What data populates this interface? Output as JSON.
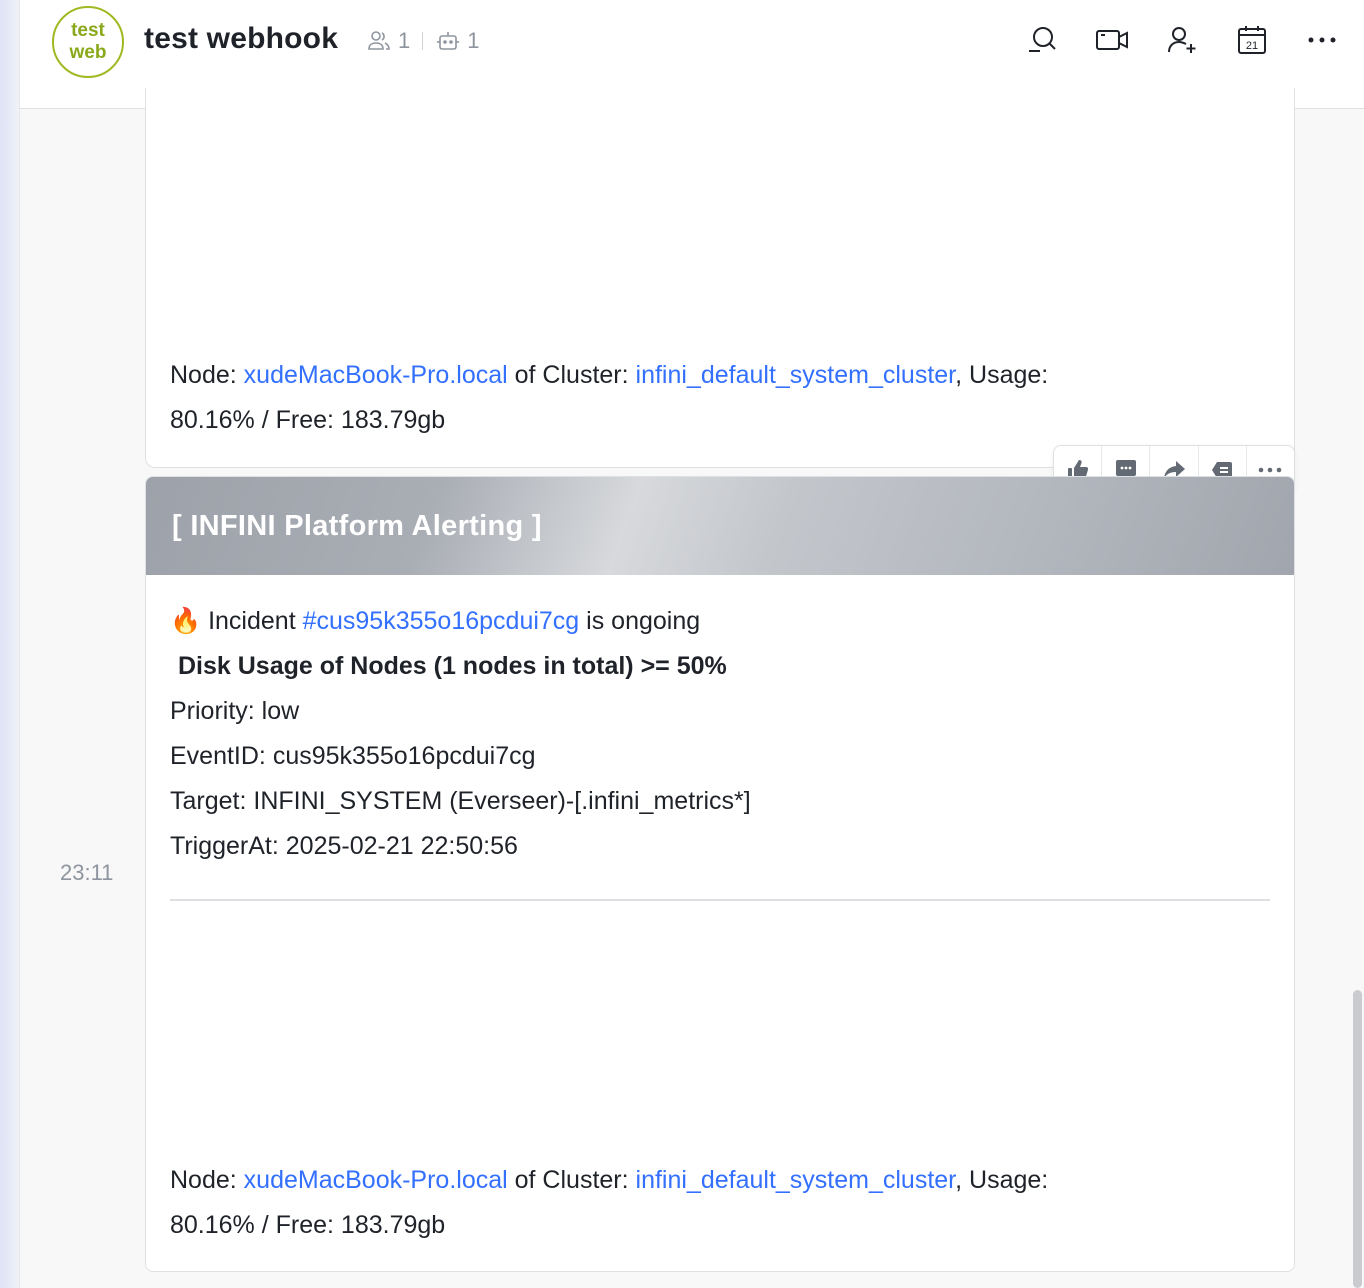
{
  "header": {
    "avatar_line1": "test",
    "avatar_line2": "web",
    "title": "test webhook",
    "member_count": "1",
    "bot_count": "1",
    "icons": [
      "search-chat-icon",
      "video-call-icon",
      "add-member-icon",
      "calendar-icon",
      "more-icon"
    ],
    "calendar_day": "21"
  },
  "message1": {
    "node_label": "Node: ",
    "node_link": "xudeMacBook-Pro.local",
    "cluster_label": " of Cluster: ",
    "cluster_link": "infini_default_system_cluster",
    "usage_label": ", Usage:",
    "usage_line": "80.16% / Free: 183.79gb"
  },
  "message2": {
    "header": "[ INFINI Platform Alerting ]",
    "emoji": "🔥",
    "incident_prefix": " Incident ",
    "incident_link": "#cus95k355o16pcdui7cg",
    "incident_suffix": " is ongoing",
    "title": "Disk Usage of Nodes (1 nodes in total) >= 50%",
    "priority": "Priority: low",
    "event_id": "EventID: cus95k355o16pcdui7cg",
    "target": "Target: INFINI_SYSTEM (Everseer)-[.infini_metrics*]",
    "trigger_at": "TriggerAt: 2025-02-21 22:50:56",
    "node_label": "Node: ",
    "node_link": "xudeMacBook-Pro.local",
    "cluster_label": " of Cluster: ",
    "cluster_link": "infini_default_system_cluster",
    "usage_label": ", Usage:",
    "usage_line": "80.16% / Free: 183.79gb",
    "time": "23:11"
  },
  "toolbar": {
    "icons": [
      "thumbs-up-icon",
      "reply-icon",
      "forward-icon",
      "quote-icon",
      "more-icon"
    ]
  },
  "colors": {
    "link": "#3370ff",
    "avatar_accent": "#9fb91f"
  }
}
